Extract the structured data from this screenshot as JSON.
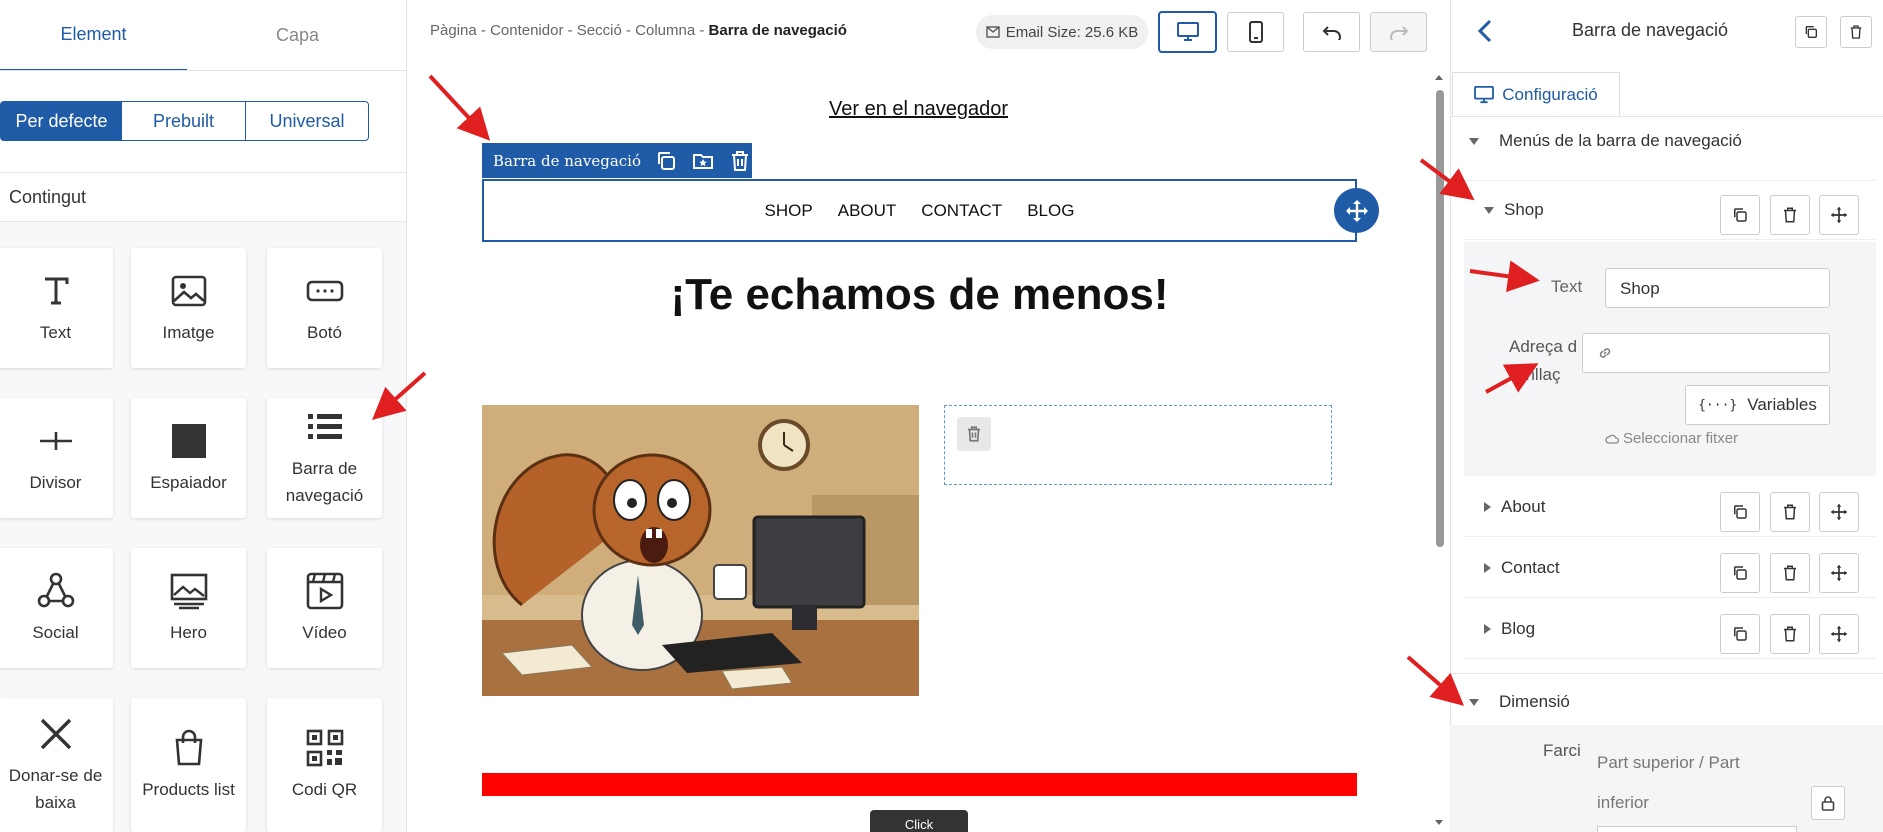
{
  "left_panel": {
    "tabs": [
      "Element",
      "Capa"
    ],
    "segments": [
      "Per defecte",
      "Prebuilt",
      "Universal"
    ],
    "section_title": "Contingut",
    "blocks": [
      {
        "label": "Text",
        "icon": "text-icon"
      },
      {
        "label": "Imatge",
        "icon": "image-icon"
      },
      {
        "label": "Botó",
        "icon": "button-icon"
      },
      {
        "label": "Divisor",
        "icon": "divider-icon"
      },
      {
        "label": "Espaiador",
        "icon": "spacer-icon"
      },
      {
        "label": "Barra de navegació",
        "icon": "navbar-icon"
      },
      {
        "label": "Social",
        "icon": "social-icon"
      },
      {
        "label": "Hero",
        "icon": "hero-icon"
      },
      {
        "label": "Vídeo",
        "icon": "video-icon"
      },
      {
        "label": "Donar-se de baixa",
        "icon": "unsubscribe-icon"
      },
      {
        "label": "Products list",
        "icon": "shopping-bag-icon"
      },
      {
        "label": "Codi QR",
        "icon": "qr-code-icon"
      }
    ]
  },
  "toolbar": {
    "breadcrumb": [
      "Pàgina",
      "Contenidor",
      "Secció",
      "Columna"
    ],
    "breadcrumb_current": "Barra de navegació",
    "breadcrumb_sep": " - ",
    "email_size": "Email Size: 25.6 KB"
  },
  "canvas": {
    "view_in_browser": "Ver en el navegador",
    "selected_label": "Barra de navegació",
    "nav_items": [
      "SHOP",
      "ABOUT",
      "CONTACT",
      "BLOG"
    ],
    "headline": "¡Te echamos de menos!",
    "bottom_button_text": "Click"
  },
  "right_panel": {
    "title": "Barra de navegació",
    "config_tab": "Configuració",
    "menus_section": "Menús de la barra de navegació",
    "menu_items": [
      "Shop",
      "About",
      "Contact",
      "Blog"
    ],
    "text_label": "Text",
    "text_value": "Shop",
    "link_label_line1": "Adreça d",
    "link_label_line2": "l'enllaç",
    "variables_button": "Variables",
    "select_file": "Seleccionar fitxer",
    "dimension_section": "Dimensió",
    "padding_label": "Farci",
    "padding_value_line1": "Part superior / Part",
    "padding_value_line2": "inferior"
  },
  "colors": {
    "accent": "#1f5ba6",
    "annotation": "#e02020",
    "red_bar": "#ff0000"
  }
}
